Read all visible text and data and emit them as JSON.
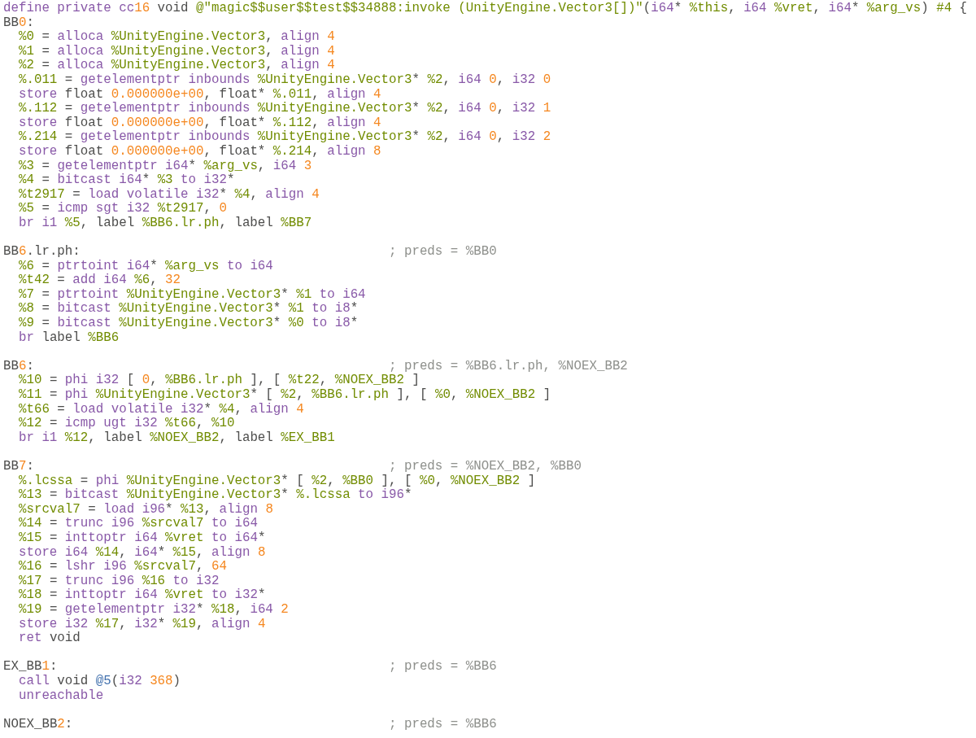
{
  "header": [
    {
      "kind": "kw",
      "text": "define private cc"
    },
    {
      "kind": "num",
      "text": "16"
    },
    {
      "kind": "txt",
      "text": " void "
    },
    {
      "kind": "var",
      "text": "@\"magic$$user$$test$$34888:invoke (UnityEngine.Vector3[])\""
    },
    {
      "kind": "txt",
      "text": "("
    },
    {
      "kind": "kw",
      "text": "i64"
    },
    {
      "kind": "txt",
      "text": "* "
    },
    {
      "kind": "var",
      "text": "%this"
    },
    {
      "kind": "txt",
      "text": ", "
    },
    {
      "kind": "kw",
      "text": "i64 "
    },
    {
      "kind": "var",
      "text": "%vret"
    },
    {
      "kind": "txt",
      "text": ", "
    },
    {
      "kind": "kw",
      "text": "i64"
    },
    {
      "kind": "txt",
      "text": "* "
    },
    {
      "kind": "var",
      "text": "%arg_vs"
    },
    {
      "kind": "txt",
      "text": ") "
    },
    {
      "kind": "var",
      "text": "#4"
    },
    {
      "kind": "txt",
      "text": " {"
    }
  ],
  "blocks": [
    {
      "label": [
        {
          "kind": "txt",
          "text": "BB"
        },
        {
          "kind": "num",
          "text": "0"
        },
        {
          "kind": "txt",
          "text": ":"
        }
      ],
      "lines": [
        [
          {
            "kind": "var",
            "text": "%0"
          },
          {
            "kind": "txt",
            "text": " = "
          },
          {
            "kind": "kw",
            "text": "alloca "
          },
          {
            "kind": "var",
            "text": "%UnityEngine.Vector3"
          },
          {
            "kind": "txt",
            "text": ", "
          },
          {
            "kind": "kw",
            "text": "align "
          },
          {
            "kind": "num",
            "text": "4"
          }
        ],
        [
          {
            "kind": "var",
            "text": "%1"
          },
          {
            "kind": "txt",
            "text": " = "
          },
          {
            "kind": "kw",
            "text": "alloca "
          },
          {
            "kind": "var",
            "text": "%UnityEngine.Vector3"
          },
          {
            "kind": "txt",
            "text": ", "
          },
          {
            "kind": "kw",
            "text": "align "
          },
          {
            "kind": "num",
            "text": "4"
          }
        ],
        [
          {
            "kind": "var",
            "text": "%2"
          },
          {
            "kind": "txt",
            "text": " = "
          },
          {
            "kind": "kw",
            "text": "alloca "
          },
          {
            "kind": "var",
            "text": "%UnityEngine.Vector3"
          },
          {
            "kind": "txt",
            "text": ", "
          },
          {
            "kind": "kw",
            "text": "align "
          },
          {
            "kind": "num",
            "text": "4"
          }
        ],
        [
          {
            "kind": "var",
            "text": "%.011"
          },
          {
            "kind": "txt",
            "text": " = "
          },
          {
            "kind": "kw",
            "text": "getelementptr inbounds "
          },
          {
            "kind": "var",
            "text": "%UnityEngine.Vector3"
          },
          {
            "kind": "txt",
            "text": "* "
          },
          {
            "kind": "var",
            "text": "%2"
          },
          {
            "kind": "txt",
            "text": ", "
          },
          {
            "kind": "kw",
            "text": "i64 "
          },
          {
            "kind": "num",
            "text": "0"
          },
          {
            "kind": "txt",
            "text": ", "
          },
          {
            "kind": "kw",
            "text": "i32 "
          },
          {
            "kind": "num",
            "text": "0"
          }
        ],
        [
          {
            "kind": "kw",
            "text": "store "
          },
          {
            "kind": "txt",
            "text": "float "
          },
          {
            "kind": "num",
            "text": "0.000000e+00"
          },
          {
            "kind": "txt",
            "text": ", float* "
          },
          {
            "kind": "var",
            "text": "%.011"
          },
          {
            "kind": "txt",
            "text": ", "
          },
          {
            "kind": "kw",
            "text": "align "
          },
          {
            "kind": "num",
            "text": "4"
          }
        ],
        [
          {
            "kind": "var",
            "text": "%.112"
          },
          {
            "kind": "txt",
            "text": " = "
          },
          {
            "kind": "kw",
            "text": "getelementptr inbounds "
          },
          {
            "kind": "var",
            "text": "%UnityEngine.Vector3"
          },
          {
            "kind": "txt",
            "text": "* "
          },
          {
            "kind": "var",
            "text": "%2"
          },
          {
            "kind": "txt",
            "text": ", "
          },
          {
            "kind": "kw",
            "text": "i64 "
          },
          {
            "kind": "num",
            "text": "0"
          },
          {
            "kind": "txt",
            "text": ", "
          },
          {
            "kind": "kw",
            "text": "i32 "
          },
          {
            "kind": "num",
            "text": "1"
          }
        ],
        [
          {
            "kind": "kw",
            "text": "store "
          },
          {
            "kind": "txt",
            "text": "float "
          },
          {
            "kind": "num",
            "text": "0.000000e+00"
          },
          {
            "kind": "txt",
            "text": ", float* "
          },
          {
            "kind": "var",
            "text": "%.112"
          },
          {
            "kind": "txt",
            "text": ", "
          },
          {
            "kind": "kw",
            "text": "align "
          },
          {
            "kind": "num",
            "text": "4"
          }
        ],
        [
          {
            "kind": "var",
            "text": "%.214"
          },
          {
            "kind": "txt",
            "text": " = "
          },
          {
            "kind": "kw",
            "text": "getelementptr inbounds "
          },
          {
            "kind": "var",
            "text": "%UnityEngine.Vector3"
          },
          {
            "kind": "txt",
            "text": "* "
          },
          {
            "kind": "var",
            "text": "%2"
          },
          {
            "kind": "txt",
            "text": ", "
          },
          {
            "kind": "kw",
            "text": "i64 "
          },
          {
            "kind": "num",
            "text": "0"
          },
          {
            "kind": "txt",
            "text": ", "
          },
          {
            "kind": "kw",
            "text": "i32 "
          },
          {
            "kind": "num",
            "text": "2"
          }
        ],
        [
          {
            "kind": "kw",
            "text": "store "
          },
          {
            "kind": "txt",
            "text": "float "
          },
          {
            "kind": "num",
            "text": "0.000000e+00"
          },
          {
            "kind": "txt",
            "text": ", float* "
          },
          {
            "kind": "var",
            "text": "%.214"
          },
          {
            "kind": "txt",
            "text": ", "
          },
          {
            "kind": "kw",
            "text": "align "
          },
          {
            "kind": "num",
            "text": "8"
          }
        ],
        [
          {
            "kind": "var",
            "text": "%3"
          },
          {
            "kind": "txt",
            "text": " = "
          },
          {
            "kind": "kw",
            "text": "getelementptr i64"
          },
          {
            "kind": "txt",
            "text": "* "
          },
          {
            "kind": "var",
            "text": "%arg_vs"
          },
          {
            "kind": "txt",
            "text": ", "
          },
          {
            "kind": "kw",
            "text": "i64 "
          },
          {
            "kind": "num",
            "text": "3"
          }
        ],
        [
          {
            "kind": "var",
            "text": "%4"
          },
          {
            "kind": "txt",
            "text": " = "
          },
          {
            "kind": "kw",
            "text": "bitcast i64"
          },
          {
            "kind": "txt",
            "text": "* "
          },
          {
            "kind": "var",
            "text": "%3"
          },
          {
            "kind": "kw",
            "text": " to i32"
          },
          {
            "kind": "txt",
            "text": "*"
          }
        ],
        [
          {
            "kind": "var",
            "text": "%t2917"
          },
          {
            "kind": "txt",
            "text": " = "
          },
          {
            "kind": "kw",
            "text": "load volatile i32"
          },
          {
            "kind": "txt",
            "text": "* "
          },
          {
            "kind": "var",
            "text": "%4"
          },
          {
            "kind": "txt",
            "text": ", "
          },
          {
            "kind": "kw",
            "text": "align "
          },
          {
            "kind": "num",
            "text": "4"
          }
        ],
        [
          {
            "kind": "var",
            "text": "%5"
          },
          {
            "kind": "txt",
            "text": " = "
          },
          {
            "kind": "kw",
            "text": "icmp sgt i32 "
          },
          {
            "kind": "var",
            "text": "%t2917"
          },
          {
            "kind": "txt",
            "text": ", "
          },
          {
            "kind": "num",
            "text": "0"
          }
        ],
        [
          {
            "kind": "kw",
            "text": "br i1 "
          },
          {
            "kind": "var",
            "text": "%5"
          },
          {
            "kind": "txt",
            "text": ", label "
          },
          {
            "kind": "var",
            "text": "%BB6.lr.ph"
          },
          {
            "kind": "txt",
            "text": ", label "
          },
          {
            "kind": "var",
            "text": "%BB7"
          }
        ]
      ]
    },
    {
      "label": [
        {
          "kind": "txt",
          "text": "BB"
        },
        {
          "kind": "num",
          "text": "6"
        },
        {
          "kind": "txt",
          "text": ".lr.ph:"
        }
      ],
      "comment": "; preds = %BB0",
      "lines": [
        [
          {
            "kind": "var",
            "text": "%6"
          },
          {
            "kind": "txt",
            "text": " = "
          },
          {
            "kind": "kw",
            "text": "ptrtoint i64"
          },
          {
            "kind": "txt",
            "text": "* "
          },
          {
            "kind": "var",
            "text": "%arg_vs"
          },
          {
            "kind": "kw",
            "text": " to i64"
          }
        ],
        [
          {
            "kind": "var",
            "text": "%t42"
          },
          {
            "kind": "txt",
            "text": " = "
          },
          {
            "kind": "kw",
            "text": "add i64 "
          },
          {
            "kind": "var",
            "text": "%6"
          },
          {
            "kind": "txt",
            "text": ", "
          },
          {
            "kind": "num",
            "text": "32"
          }
        ],
        [
          {
            "kind": "var",
            "text": "%7"
          },
          {
            "kind": "txt",
            "text": " = "
          },
          {
            "kind": "kw",
            "text": "ptrtoint "
          },
          {
            "kind": "var",
            "text": "%UnityEngine.Vector3"
          },
          {
            "kind": "txt",
            "text": "* "
          },
          {
            "kind": "var",
            "text": "%1"
          },
          {
            "kind": "kw",
            "text": " to i64"
          }
        ],
        [
          {
            "kind": "var",
            "text": "%8"
          },
          {
            "kind": "txt",
            "text": " = "
          },
          {
            "kind": "kw",
            "text": "bitcast "
          },
          {
            "kind": "var",
            "text": "%UnityEngine.Vector3"
          },
          {
            "kind": "txt",
            "text": "* "
          },
          {
            "kind": "var",
            "text": "%1"
          },
          {
            "kind": "kw",
            "text": " to i8"
          },
          {
            "kind": "txt",
            "text": "*"
          }
        ],
        [
          {
            "kind": "var",
            "text": "%9"
          },
          {
            "kind": "txt",
            "text": " = "
          },
          {
            "kind": "kw",
            "text": "bitcast "
          },
          {
            "kind": "var",
            "text": "%UnityEngine.Vector3"
          },
          {
            "kind": "txt",
            "text": "* "
          },
          {
            "kind": "var",
            "text": "%0"
          },
          {
            "kind": "kw",
            "text": " to i8"
          },
          {
            "kind": "txt",
            "text": "*"
          }
        ],
        [
          {
            "kind": "kw",
            "text": "br "
          },
          {
            "kind": "txt",
            "text": "label "
          },
          {
            "kind": "var",
            "text": "%BB6"
          }
        ]
      ]
    },
    {
      "label": [
        {
          "kind": "txt",
          "text": "BB"
        },
        {
          "kind": "num",
          "text": "6"
        },
        {
          "kind": "txt",
          "text": ":"
        }
      ],
      "comment": "; preds = %BB6.lr.ph, %NOEX_BB2",
      "lines": [
        [
          {
            "kind": "var",
            "text": "%10"
          },
          {
            "kind": "txt",
            "text": " = "
          },
          {
            "kind": "kw",
            "text": "phi i32 "
          },
          {
            "kind": "txt",
            "text": "[ "
          },
          {
            "kind": "num",
            "text": "0"
          },
          {
            "kind": "txt",
            "text": ", "
          },
          {
            "kind": "var",
            "text": "%BB6.lr.ph"
          },
          {
            "kind": "txt",
            "text": " ], [ "
          },
          {
            "kind": "var",
            "text": "%t22"
          },
          {
            "kind": "txt",
            "text": ", "
          },
          {
            "kind": "var",
            "text": "%NOEX_BB2"
          },
          {
            "kind": "txt",
            "text": " ]"
          }
        ],
        [
          {
            "kind": "var",
            "text": "%11"
          },
          {
            "kind": "txt",
            "text": " = "
          },
          {
            "kind": "kw",
            "text": "phi "
          },
          {
            "kind": "var",
            "text": "%UnityEngine.Vector3"
          },
          {
            "kind": "txt",
            "text": "* [ "
          },
          {
            "kind": "var",
            "text": "%2"
          },
          {
            "kind": "txt",
            "text": ", "
          },
          {
            "kind": "var",
            "text": "%BB6.lr.ph"
          },
          {
            "kind": "txt",
            "text": " ], [ "
          },
          {
            "kind": "var",
            "text": "%0"
          },
          {
            "kind": "txt",
            "text": ", "
          },
          {
            "kind": "var",
            "text": "%NOEX_BB2"
          },
          {
            "kind": "txt",
            "text": " ]"
          }
        ],
        [
          {
            "kind": "var",
            "text": "%t66"
          },
          {
            "kind": "txt",
            "text": " = "
          },
          {
            "kind": "kw",
            "text": "load volatile i32"
          },
          {
            "kind": "txt",
            "text": "* "
          },
          {
            "kind": "var",
            "text": "%4"
          },
          {
            "kind": "txt",
            "text": ", "
          },
          {
            "kind": "kw",
            "text": "align "
          },
          {
            "kind": "num",
            "text": "4"
          }
        ],
        [
          {
            "kind": "var",
            "text": "%12"
          },
          {
            "kind": "txt",
            "text": " = "
          },
          {
            "kind": "kw",
            "text": "icmp ugt i32 "
          },
          {
            "kind": "var",
            "text": "%t66"
          },
          {
            "kind": "txt",
            "text": ", "
          },
          {
            "kind": "var",
            "text": "%10"
          }
        ],
        [
          {
            "kind": "kw",
            "text": "br i1 "
          },
          {
            "kind": "var",
            "text": "%12"
          },
          {
            "kind": "txt",
            "text": ", label "
          },
          {
            "kind": "var",
            "text": "%NOEX_BB2"
          },
          {
            "kind": "txt",
            "text": ", label "
          },
          {
            "kind": "var",
            "text": "%EX_BB1"
          }
        ]
      ]
    },
    {
      "label": [
        {
          "kind": "txt",
          "text": "BB"
        },
        {
          "kind": "num",
          "text": "7"
        },
        {
          "kind": "txt",
          "text": ":"
        }
      ],
      "comment": "; preds = %NOEX_BB2, %BB0",
      "lines": [
        [
          {
            "kind": "var",
            "text": "%.lcssa"
          },
          {
            "kind": "txt",
            "text": " = "
          },
          {
            "kind": "kw",
            "text": "phi "
          },
          {
            "kind": "var",
            "text": "%UnityEngine.Vector3"
          },
          {
            "kind": "txt",
            "text": "* [ "
          },
          {
            "kind": "var",
            "text": "%2"
          },
          {
            "kind": "txt",
            "text": ", "
          },
          {
            "kind": "var",
            "text": "%BB0"
          },
          {
            "kind": "txt",
            "text": " ], [ "
          },
          {
            "kind": "var",
            "text": "%0"
          },
          {
            "kind": "txt",
            "text": ", "
          },
          {
            "kind": "var",
            "text": "%NOEX_BB2"
          },
          {
            "kind": "txt",
            "text": " ]"
          }
        ],
        [
          {
            "kind": "var",
            "text": "%13"
          },
          {
            "kind": "txt",
            "text": " = "
          },
          {
            "kind": "kw",
            "text": "bitcast "
          },
          {
            "kind": "var",
            "text": "%UnityEngine.Vector3"
          },
          {
            "kind": "txt",
            "text": "* "
          },
          {
            "kind": "var",
            "text": "%.lcssa"
          },
          {
            "kind": "kw",
            "text": " to i96"
          },
          {
            "kind": "txt",
            "text": "*"
          }
        ],
        [
          {
            "kind": "var",
            "text": "%srcval7"
          },
          {
            "kind": "txt",
            "text": " = "
          },
          {
            "kind": "kw",
            "text": "load i96"
          },
          {
            "kind": "txt",
            "text": "* "
          },
          {
            "kind": "var",
            "text": "%13"
          },
          {
            "kind": "txt",
            "text": ", "
          },
          {
            "kind": "kw",
            "text": "align "
          },
          {
            "kind": "num",
            "text": "8"
          }
        ],
        [
          {
            "kind": "var",
            "text": "%14"
          },
          {
            "kind": "txt",
            "text": " = "
          },
          {
            "kind": "kw",
            "text": "trunc i96 "
          },
          {
            "kind": "var",
            "text": "%srcval7"
          },
          {
            "kind": "kw",
            "text": " to i64"
          }
        ],
        [
          {
            "kind": "var",
            "text": "%15"
          },
          {
            "kind": "txt",
            "text": " = "
          },
          {
            "kind": "kw",
            "text": "inttoptr i64 "
          },
          {
            "kind": "var",
            "text": "%vret"
          },
          {
            "kind": "kw",
            "text": " to i64"
          },
          {
            "kind": "txt",
            "text": "*"
          }
        ],
        [
          {
            "kind": "kw",
            "text": "store i64 "
          },
          {
            "kind": "var",
            "text": "%14"
          },
          {
            "kind": "txt",
            "text": ", "
          },
          {
            "kind": "kw",
            "text": "i64"
          },
          {
            "kind": "txt",
            "text": "* "
          },
          {
            "kind": "var",
            "text": "%15"
          },
          {
            "kind": "txt",
            "text": ", "
          },
          {
            "kind": "kw",
            "text": "align "
          },
          {
            "kind": "num",
            "text": "8"
          }
        ],
        [
          {
            "kind": "var",
            "text": "%16"
          },
          {
            "kind": "txt",
            "text": " = "
          },
          {
            "kind": "kw",
            "text": "lshr i96 "
          },
          {
            "kind": "var",
            "text": "%srcval7"
          },
          {
            "kind": "txt",
            "text": ", "
          },
          {
            "kind": "num",
            "text": "64"
          }
        ],
        [
          {
            "kind": "var",
            "text": "%17"
          },
          {
            "kind": "txt",
            "text": " = "
          },
          {
            "kind": "kw",
            "text": "trunc i96 "
          },
          {
            "kind": "var",
            "text": "%16"
          },
          {
            "kind": "kw",
            "text": " to i32"
          }
        ],
        [
          {
            "kind": "var",
            "text": "%18"
          },
          {
            "kind": "txt",
            "text": " = "
          },
          {
            "kind": "kw",
            "text": "inttoptr i64 "
          },
          {
            "kind": "var",
            "text": "%vret"
          },
          {
            "kind": "kw",
            "text": " to i32"
          },
          {
            "kind": "txt",
            "text": "*"
          }
        ],
        [
          {
            "kind": "var",
            "text": "%19"
          },
          {
            "kind": "txt",
            "text": " = "
          },
          {
            "kind": "kw",
            "text": "getelementptr i32"
          },
          {
            "kind": "txt",
            "text": "* "
          },
          {
            "kind": "var",
            "text": "%18"
          },
          {
            "kind": "txt",
            "text": ", "
          },
          {
            "kind": "kw",
            "text": "i64 "
          },
          {
            "kind": "num",
            "text": "2"
          }
        ],
        [
          {
            "kind": "kw",
            "text": "store i32 "
          },
          {
            "kind": "var",
            "text": "%17"
          },
          {
            "kind": "txt",
            "text": ", "
          },
          {
            "kind": "kw",
            "text": "i32"
          },
          {
            "kind": "txt",
            "text": "* "
          },
          {
            "kind": "var",
            "text": "%19"
          },
          {
            "kind": "txt",
            "text": ", "
          },
          {
            "kind": "kw",
            "text": "align "
          },
          {
            "kind": "num",
            "text": "4"
          }
        ],
        [
          {
            "kind": "kw",
            "text": "ret "
          },
          {
            "kind": "txt",
            "text": "void"
          }
        ]
      ]
    },
    {
      "label": [
        {
          "kind": "txt",
          "text": "EX_BB"
        },
        {
          "kind": "num",
          "text": "1"
        },
        {
          "kind": "txt",
          "text": ":"
        }
      ],
      "comment": "; preds = %BB6",
      "lines": [
        [
          {
            "kind": "kw",
            "text": "call "
          },
          {
            "kind": "txt",
            "text": "void "
          },
          {
            "kind": "glb",
            "text": "@5"
          },
          {
            "kind": "txt",
            "text": "("
          },
          {
            "kind": "kw",
            "text": "i32 "
          },
          {
            "kind": "num",
            "text": "368"
          },
          {
            "kind": "txt",
            "text": ")"
          }
        ],
        [
          {
            "kind": "kw",
            "text": "unreachable"
          }
        ]
      ]
    },
    {
      "label": [
        {
          "kind": "txt",
          "text": "NOEX_BB"
        },
        {
          "kind": "num",
          "text": "2"
        },
        {
          "kind": "txt",
          "text": ":"
        }
      ],
      "comment": "; preds = %BB6"
    }
  ]
}
